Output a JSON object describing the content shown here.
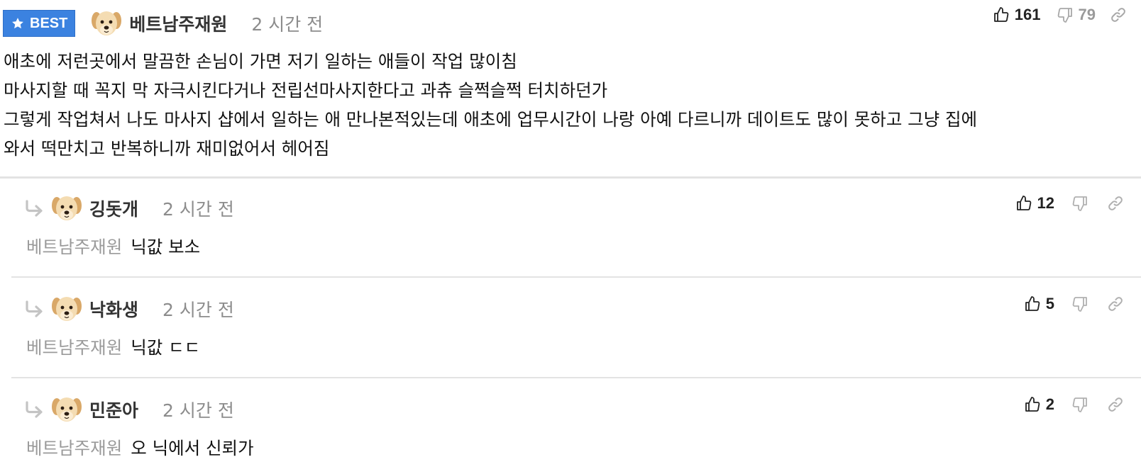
{
  "main_comment": {
    "badge": {
      "label": "BEST",
      "icon": "star-icon",
      "color": "#3b82e0"
    },
    "author": "베트남주재원",
    "time": "2 시간 전",
    "likes": "161",
    "dislikes": "79",
    "lines": [
      "애초에 저런곳에서 말끔한 손님이 가면 저기 일하는 애들이 작업 많이침",
      "마사지할 때 꼭지 막 자극시킨다거나 전립선마사지한다고 과츄 슬쩍슬쩍 터치하던가",
      "그렇게 작업쳐서 나도 마사지 샵에서 일하는 애 만나본적있는데 애초에 업무시간이 나랑 아예 다르니까 데이트도 많이 못하고 그냥 집에",
      "와서 떡만치고 반복하니까 재미없어서 헤어짐"
    ]
  },
  "replies": [
    {
      "author": "깅돗개",
      "time": "2 시간 전",
      "likes": "12",
      "dislikes": "",
      "mention": "베트남주재원",
      "text": "닉값 보소"
    },
    {
      "author": "낙화생",
      "time": "2 시간 전",
      "likes": "5",
      "dislikes": "",
      "mention": "베트남주재원",
      "text": "닉값 ㄷㄷ"
    },
    {
      "author": "민준아",
      "time": "2 시간 전",
      "likes": "2",
      "dislikes": "",
      "mention": "베트남주재원",
      "text": "오 닉에서 신뢰가"
    }
  ],
  "icons": {
    "like": "thumbs-up-icon",
    "dislike": "thumbs-down-icon",
    "link": "link-icon",
    "reply": "reply-arrow-icon",
    "avatar": "puppy-avatar"
  },
  "colors": {
    "best_badge": "#3b82e0",
    "muted_text": "#8c8c8c",
    "divider": "#e3e3e3"
  }
}
